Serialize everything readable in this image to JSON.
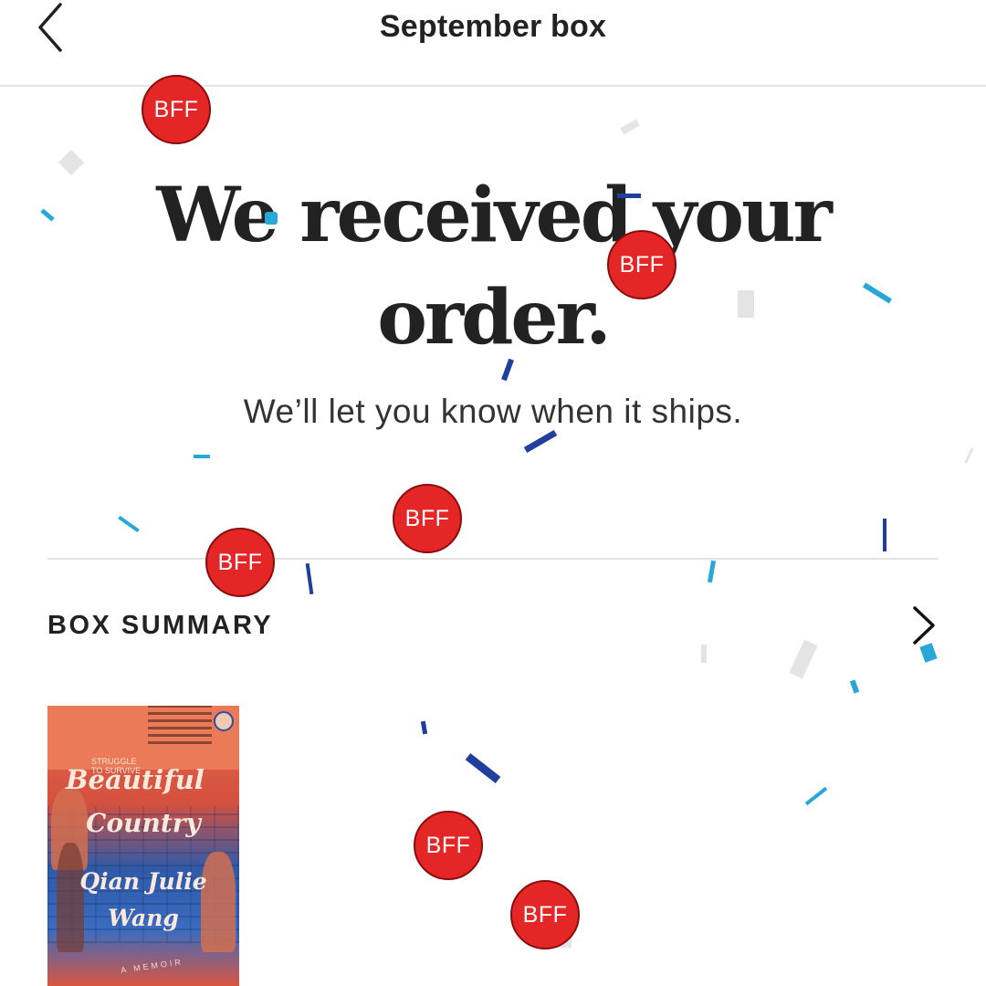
{
  "header": {
    "title": "September box",
    "back_icon": "chevron-left-icon"
  },
  "hero": {
    "line1": "We received your",
    "line2": "order.",
    "subtitle": "We’ll let you know when it ships."
  },
  "summary": {
    "label": "BOX SUMMARY",
    "chevron_icon": "chevron-right-icon"
  },
  "book": {
    "tagline_line1": "STRUGGLE",
    "tagline_line2": "TO SURVIVE",
    "title_line1": "Beautiful",
    "title_line2": "Country",
    "author_line1": "Qian Julie",
    "author_line2": "Wang",
    "subtitle": "A MEMOIR"
  },
  "badges": [
    "BFF",
    "BFF",
    "BFF",
    "BFF",
    "BFF",
    "BFF"
  ],
  "colors": {
    "badge_red": "#e52626",
    "confetti_light_blue": "#29a8d8",
    "confetti_dark_blue": "#1f3f9c",
    "confetti_gray": "#e4e4e4"
  }
}
